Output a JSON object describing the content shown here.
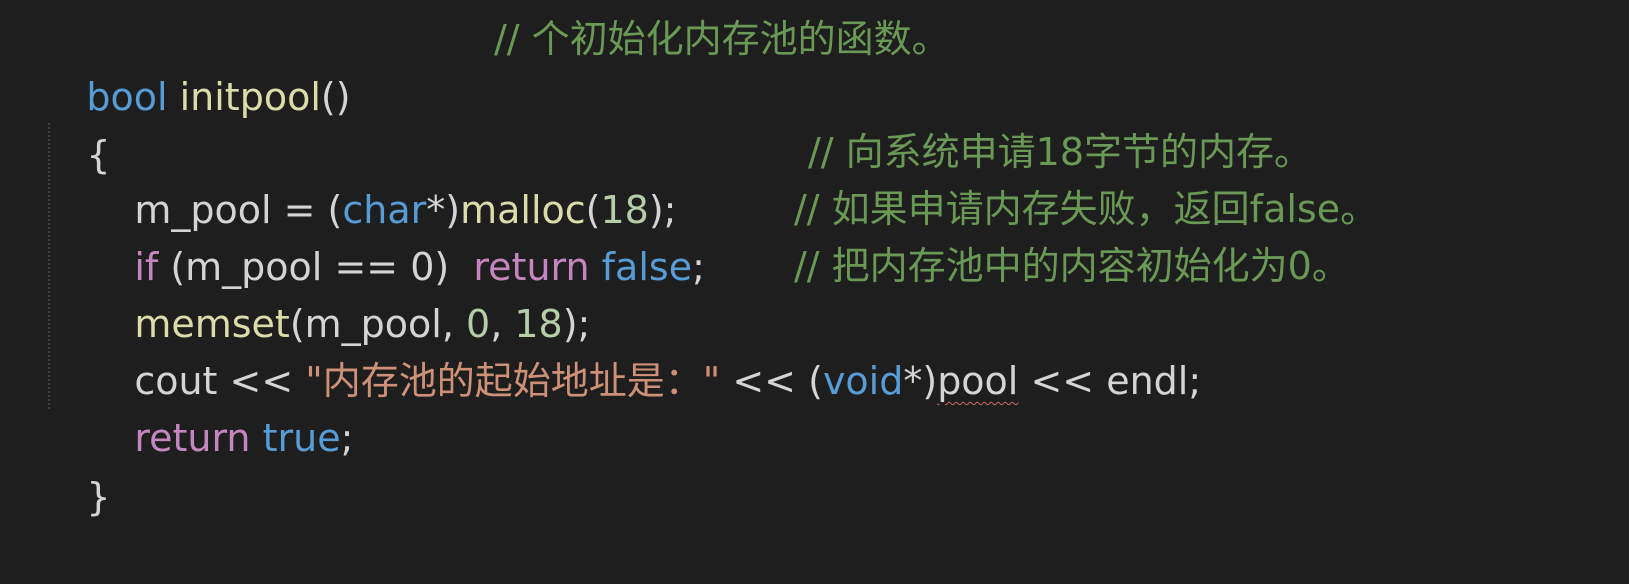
{
  "code": {
    "line1": {
      "kw": "bool",
      "space": " ",
      "name": "initpool",
      "parens": "()",
      "comment": "// 个初始化内存池的函数。"
    },
    "line2": {
      "brace": "{"
    },
    "line3": {
      "lhs": "m_pool = (",
      "type": "char",
      "ptr": "*)",
      "fn": "malloc",
      "open": "(",
      "num": "18",
      "close": ");",
      "comment": "// 向系统申请18字节的内存。"
    },
    "line4": {
      "kw_if": "if",
      "cond": " (m_pool == 0)  ",
      "kw_return": "return",
      "space": " ",
      "kw_false": "false",
      "semi": ";",
      "comment": "// 如果申请内存失败，返回false。"
    },
    "line5": {
      "fn": "memset",
      "args_open": "(m_pool, ",
      "num1": "0",
      "comma": ", ",
      "num2": "18",
      "close": ");",
      "comment": "// 把内存池中的内容初始化为0。"
    },
    "line6": {
      "cout": "cout << ",
      "str": "\"内存池的起始地址是：\"",
      "op": " << (",
      "type": "void",
      "ptr": "*)",
      "pool": "pool",
      "tail": " << endl;"
    },
    "line7": {
      "kw_return": "return",
      "space": " ",
      "kw_true": "true",
      "semi": ";"
    },
    "line8": {
      "brace": "}"
    }
  }
}
